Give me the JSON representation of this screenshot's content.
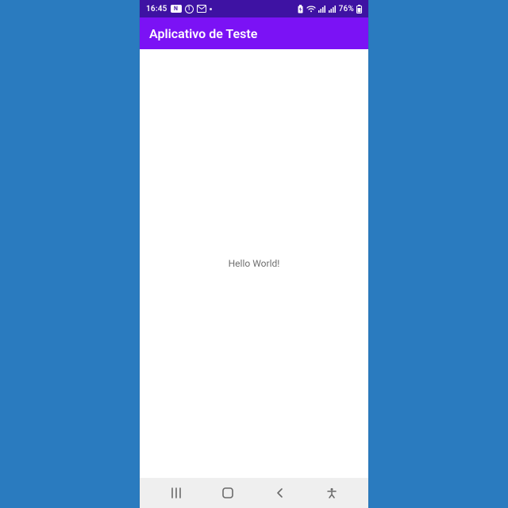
{
  "status": {
    "time": "16:45",
    "icon_nfc": "N",
    "icon_alarm": "1",
    "icon_mail": "M",
    "battery_percent": "76%"
  },
  "appbar": {
    "title": "Aplicativo de Teste"
  },
  "content": {
    "message": "Hello World!"
  }
}
